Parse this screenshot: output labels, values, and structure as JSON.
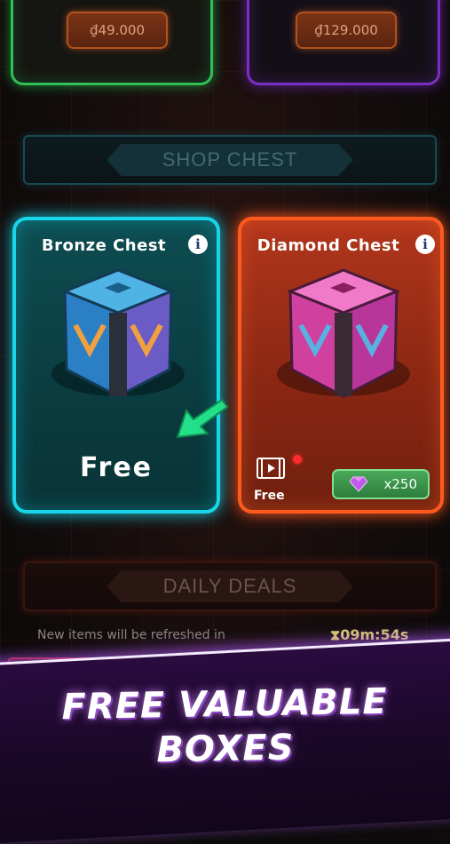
{
  "packages": [
    {
      "price": "₫49.000",
      "color": "#2fbf55"
    },
    {
      "price": "₫129.000",
      "color": "#7a2fc2"
    }
  ],
  "sections": {
    "shop_chest": "SHOP CHEST",
    "daily_deals": "DAILY DEALS"
  },
  "chests": {
    "bronze": {
      "title": "Bronze Chest",
      "action": "Free",
      "color": "#19d5e8"
    },
    "diamond": {
      "title": "Diamond Chest",
      "video_label": "Free",
      "gem_cost": "x250",
      "color": "#ff5a1e"
    }
  },
  "info_glyph": "i",
  "refresh": {
    "text": "New items will be refreshed in",
    "timer": "09m:54s",
    "icon": "hourglass-icon"
  },
  "promo": {
    "line1": "FREE VALUABLE",
    "line2": "BOXES"
  }
}
